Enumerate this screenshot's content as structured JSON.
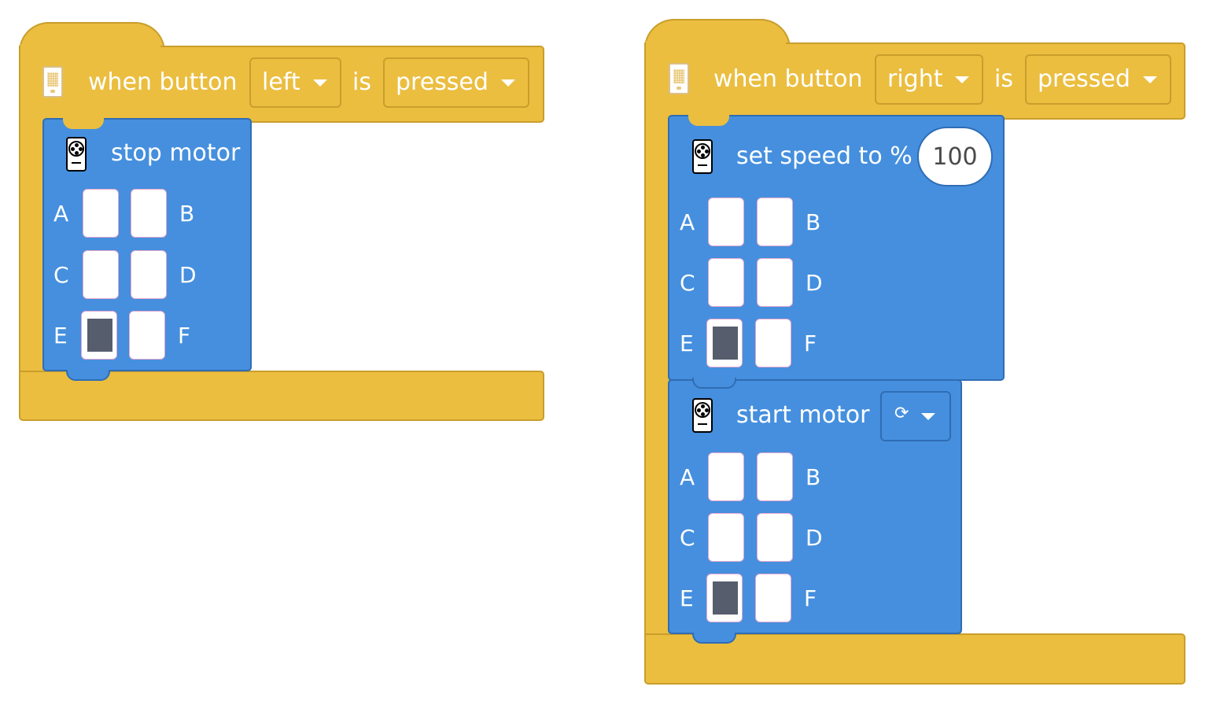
{
  "colors": {
    "event_block": "#ebbe40",
    "event_border": "#c99e2c",
    "motor_block": "#458fde",
    "motor_border": "#2f6db4",
    "port_selected": "#565d6d"
  },
  "stacks": [
    {
      "hat": {
        "icon": "hub-icon",
        "prefix": "when button",
        "button": "left",
        "middle": "is",
        "state": "pressed"
      },
      "blocks": [
        {
          "icon": "motor-icon",
          "label": "stop motor",
          "ports": [
            "A",
            "B",
            "C",
            "D",
            "E",
            "F"
          ],
          "selected_ports": [
            "E"
          ]
        }
      ]
    },
    {
      "hat": {
        "icon": "hub-icon",
        "prefix": "when button",
        "button": "right",
        "middle": "is",
        "state": "pressed"
      },
      "blocks": [
        {
          "icon": "motor-icon",
          "label": "set speed to %",
          "value": "100",
          "ports": [
            "A",
            "B",
            "C",
            "D",
            "E",
            "F"
          ],
          "selected_ports": [
            "E"
          ]
        },
        {
          "icon": "motor-icon",
          "label": "start motor",
          "direction_icon": "clockwise-arrow-icon",
          "direction_glyph": "⟳",
          "ports": [
            "A",
            "B",
            "C",
            "D",
            "E",
            "F"
          ],
          "selected_ports": [
            "E"
          ]
        }
      ]
    }
  ]
}
